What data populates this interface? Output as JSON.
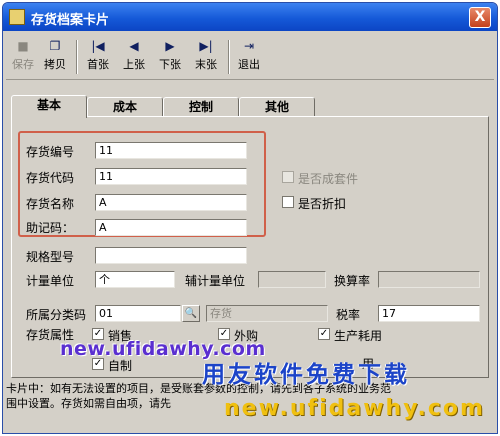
{
  "window": {
    "title": "存货档案卡片",
    "close_glyph": "X"
  },
  "toolbar": {
    "buttons": [
      {
        "label": "保存",
        "icon": "■",
        "enabled": false
      },
      {
        "label": "拷贝",
        "icon": "❐",
        "enabled": true
      },
      {
        "label": "首张",
        "icon": "|◀",
        "enabled": true
      },
      {
        "label": "上张",
        "icon": "◀",
        "enabled": true
      },
      {
        "label": "下张",
        "icon": "▶",
        "enabled": true
      },
      {
        "label": "末张",
        "icon": "▶|",
        "enabled": true
      },
      {
        "label": "退出",
        "icon": "⇥",
        "enabled": true
      }
    ]
  },
  "tabs": [
    {
      "label": "基本",
      "active": true
    },
    {
      "label": "成本",
      "active": false
    },
    {
      "label": "控制",
      "active": false
    },
    {
      "label": "其他",
      "active": false
    }
  ],
  "form": {
    "inventory_code": {
      "label": "存货编号",
      "value": "11"
    },
    "inventory_alias": {
      "label": "存货代码",
      "value": "11"
    },
    "inventory_name": {
      "label": "存货名称",
      "value": "A"
    },
    "mnemonic_code": {
      "label": "助记码：",
      "value": "A"
    },
    "spec_model": {
      "label": "规格型号",
      "value": ""
    },
    "unit": {
      "label": "计量单位",
      "value": "个"
    },
    "aux_unit": {
      "label": "辅计量单位",
      "value": ""
    },
    "conversion_rate": {
      "label": "换算率",
      "value": ""
    },
    "category_code": {
      "label": "所属分类码",
      "value": "01",
      "category_name": "存货"
    },
    "tax_rate": {
      "label": "税率",
      "value": "17"
    },
    "attributes_label": "存货属性",
    "is_kit": {
      "label": "是否成套件",
      "checked": false,
      "enabled": false
    },
    "is_discount": {
      "label": "是否折扣",
      "checked": false,
      "enabled": true
    },
    "attr_sales": {
      "label": "销售",
      "checked": true
    },
    "attr_purchase": {
      "label": "外购",
      "checked": true
    },
    "attr_production": {
      "label": "生产耗用",
      "checked": true
    },
    "attr_selfmade": {
      "label": "自制",
      "checked": true
    },
    "attr_partial_b": "用"
  },
  "status": {
    "line1": "卡片中：如有无法设置的项目，是受账套参数的控制，请先到各子系统的业务范",
    "line2": "围中设置。存货如需自由项，请先"
  },
  "overlays": {
    "watermark_url": "new.ufidawhy.com",
    "watermark_slogan": "用友软件免费下载",
    "watermark_url2": "new.ufidawhy.com"
  },
  "colors": {
    "titlebar": "#1559d8",
    "highlight_box": "#d0604a",
    "watermark_slogan": "#1c44c8",
    "watermark_url2": "#f0c010"
  }
}
